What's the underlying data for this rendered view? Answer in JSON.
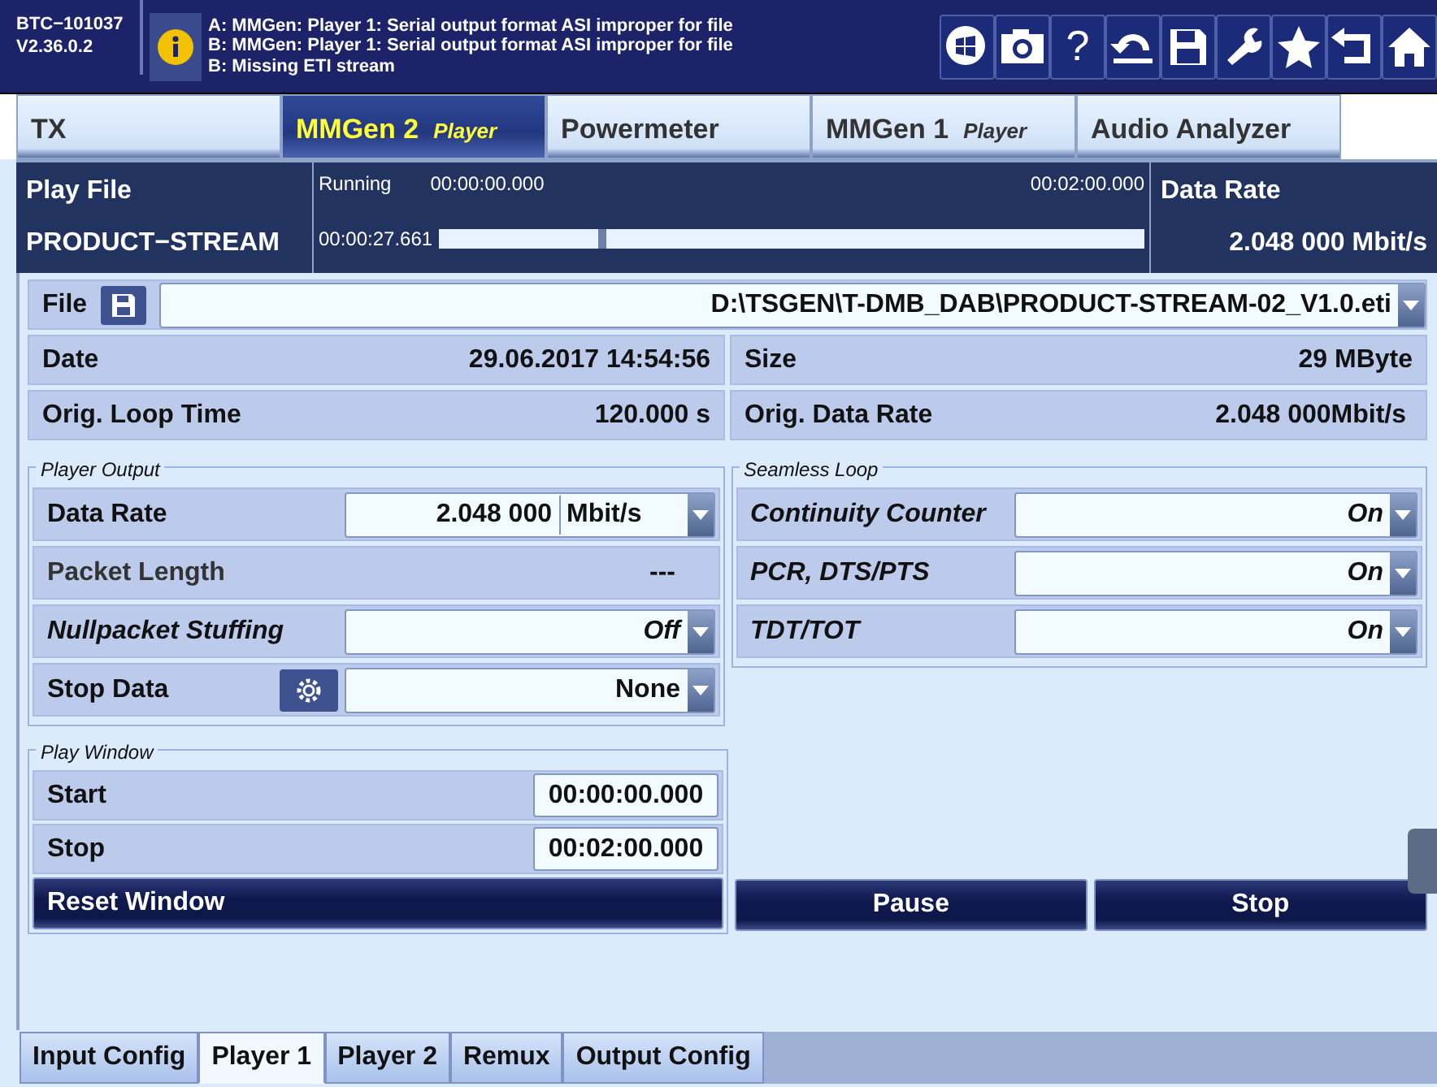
{
  "device": {
    "id": "BTC−101037",
    "version": "V2.36.0.2"
  },
  "messages": [
    "A: MMGen: Player 1: Serial output format ASI improper for file",
    "B: MMGen: Player 1: Serial output format ASI improper for file",
    "B: Missing ETI stream"
  ],
  "toolbar": [
    {
      "kind": "windows"
    },
    {
      "kind": "camera"
    },
    {
      "kind": "help",
      "glyph": "?"
    },
    {
      "kind": "undo"
    },
    {
      "kind": "save"
    },
    {
      "kind": "wrench"
    },
    {
      "kind": "star"
    },
    {
      "kind": "back"
    },
    {
      "kind": "home"
    }
  ],
  "tabs": [
    {
      "label": "TX",
      "selected": false
    },
    {
      "label": "MMGen 2",
      "sublabel": "Player",
      "selected": true
    },
    {
      "label": "Powermeter",
      "selected": false
    },
    {
      "label": "MMGen 1",
      "sublabel": "Player",
      "selected": false
    },
    {
      "label": "Audio Analyzer",
      "selected": false
    }
  ],
  "status": {
    "title": "Play File",
    "file": "PRODUCT−STREAM",
    "state": "Running",
    "start": "00:00:00.000",
    "end": "00:02:00.000",
    "position": "00:00:27.661",
    "level": 0.23,
    "rate_title": "Data Rate",
    "rate_value": "2.048 000",
    "rate_unit": "Mbit/s"
  },
  "file": {
    "label": "File",
    "path": "D:\\TSGEN\\T-DMB_DAB\\PRODUCT-STREAM-02_V1.0.eti"
  },
  "info": [
    {
      "label": "Date",
      "value": "29.06.2017 14:54:56"
    },
    {
      "label": "Size",
      "value": "29 MByte"
    },
    {
      "label": "Orig. Loop Time",
      "value": "120.000 s"
    },
    {
      "label": "Orig. Data Rate",
      "value": "2.048 000",
      "unit": "Mbit/s"
    }
  ],
  "player_output": {
    "title": "Player Output",
    "rows": [
      {
        "kind": "number-unit",
        "label": "Data Rate",
        "emphasized": false,
        "value": "2.048 000",
        "unit": "Mbit/s"
      },
      {
        "kind": "readout",
        "label": "Packet Length",
        "emphasized": false,
        "value": "---"
      },
      {
        "kind": "select",
        "label": "Nullpacket Stuffing",
        "emphasized": true,
        "value": "Off"
      },
      {
        "kind": "select-gear",
        "label": "Stop Data",
        "emphasized": false,
        "value": "None"
      }
    ]
  },
  "seamless_loop": {
    "title": "Seamless Loop",
    "rows": [
      {
        "kind": "select",
        "label": "Continuity Counter",
        "emphasized": true,
        "value": "On"
      },
      {
        "kind": "select",
        "label": "PCR, DTS/PTS",
        "emphasized": true,
        "value": "On"
      },
      {
        "kind": "select",
        "label": "TDT/TOT",
        "emphasized": true,
        "value": "On"
      }
    ]
  },
  "play_window": {
    "title": "Play Window",
    "rows": [
      {
        "label": "Start",
        "value": "00:00:00.000"
      },
      {
        "label": "Stop",
        "value": "00:02:00.000"
      }
    ],
    "reset": "Reset Window"
  },
  "actions": [
    "Pause",
    "Stop"
  ],
  "bottom_tabs": [
    {
      "label": "Input Config",
      "selected": false
    },
    {
      "label": "Player 1",
      "selected": true
    },
    {
      "label": "Player 2",
      "selected": false
    },
    {
      "label": "Remux",
      "selected": false
    },
    {
      "label": "Output Config",
      "selected": false
    }
  ]
}
